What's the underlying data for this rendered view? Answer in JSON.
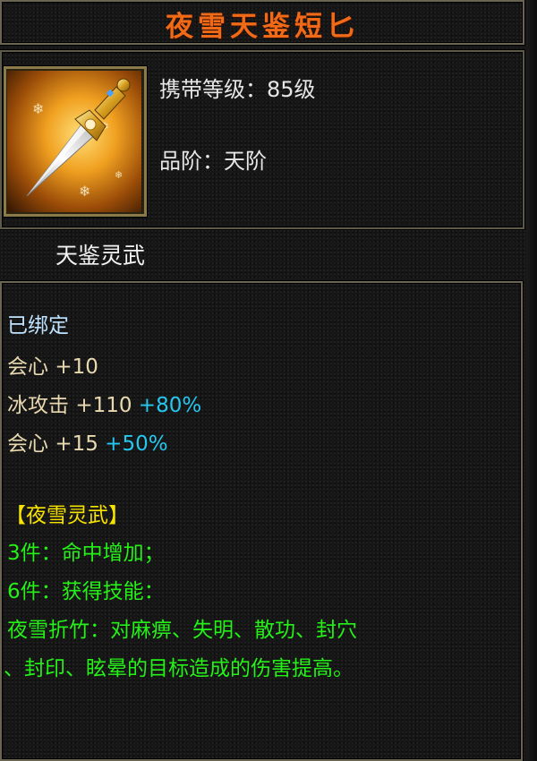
{
  "item": {
    "name": "夜雪天鉴短匕",
    "level_label": "携带等级：85级",
    "grade_label": "品阶：天阶",
    "icon": "dagger-icon",
    "subtitle": "天鉴灵武"
  },
  "attributes": {
    "bound": "已绑定",
    "lines": [
      {
        "label": "会心",
        "value": "+10",
        "pct": ""
      },
      {
        "label": "冰攻击",
        "value": "+110",
        "pct": "+80%"
      },
      {
        "label": "会心",
        "value": "+15",
        "pct": "+50%"
      }
    ]
  },
  "set": {
    "name": "【夜雪灵武】",
    "bonus3": "3件：命中增加；",
    "bonus6": "6件：获得技能：",
    "skill_line1": "夜雪折竹：对麻痹、失明、散功、封穴",
    "skill_line2": "、封印、眩晕的目标造成的伤害提高。"
  },
  "colors": {
    "title": "#f06a18",
    "set_name": "#f7e300",
    "set_text": "#25f018",
    "percent": "#26c7ee",
    "bound": "#bfe3ff"
  }
}
